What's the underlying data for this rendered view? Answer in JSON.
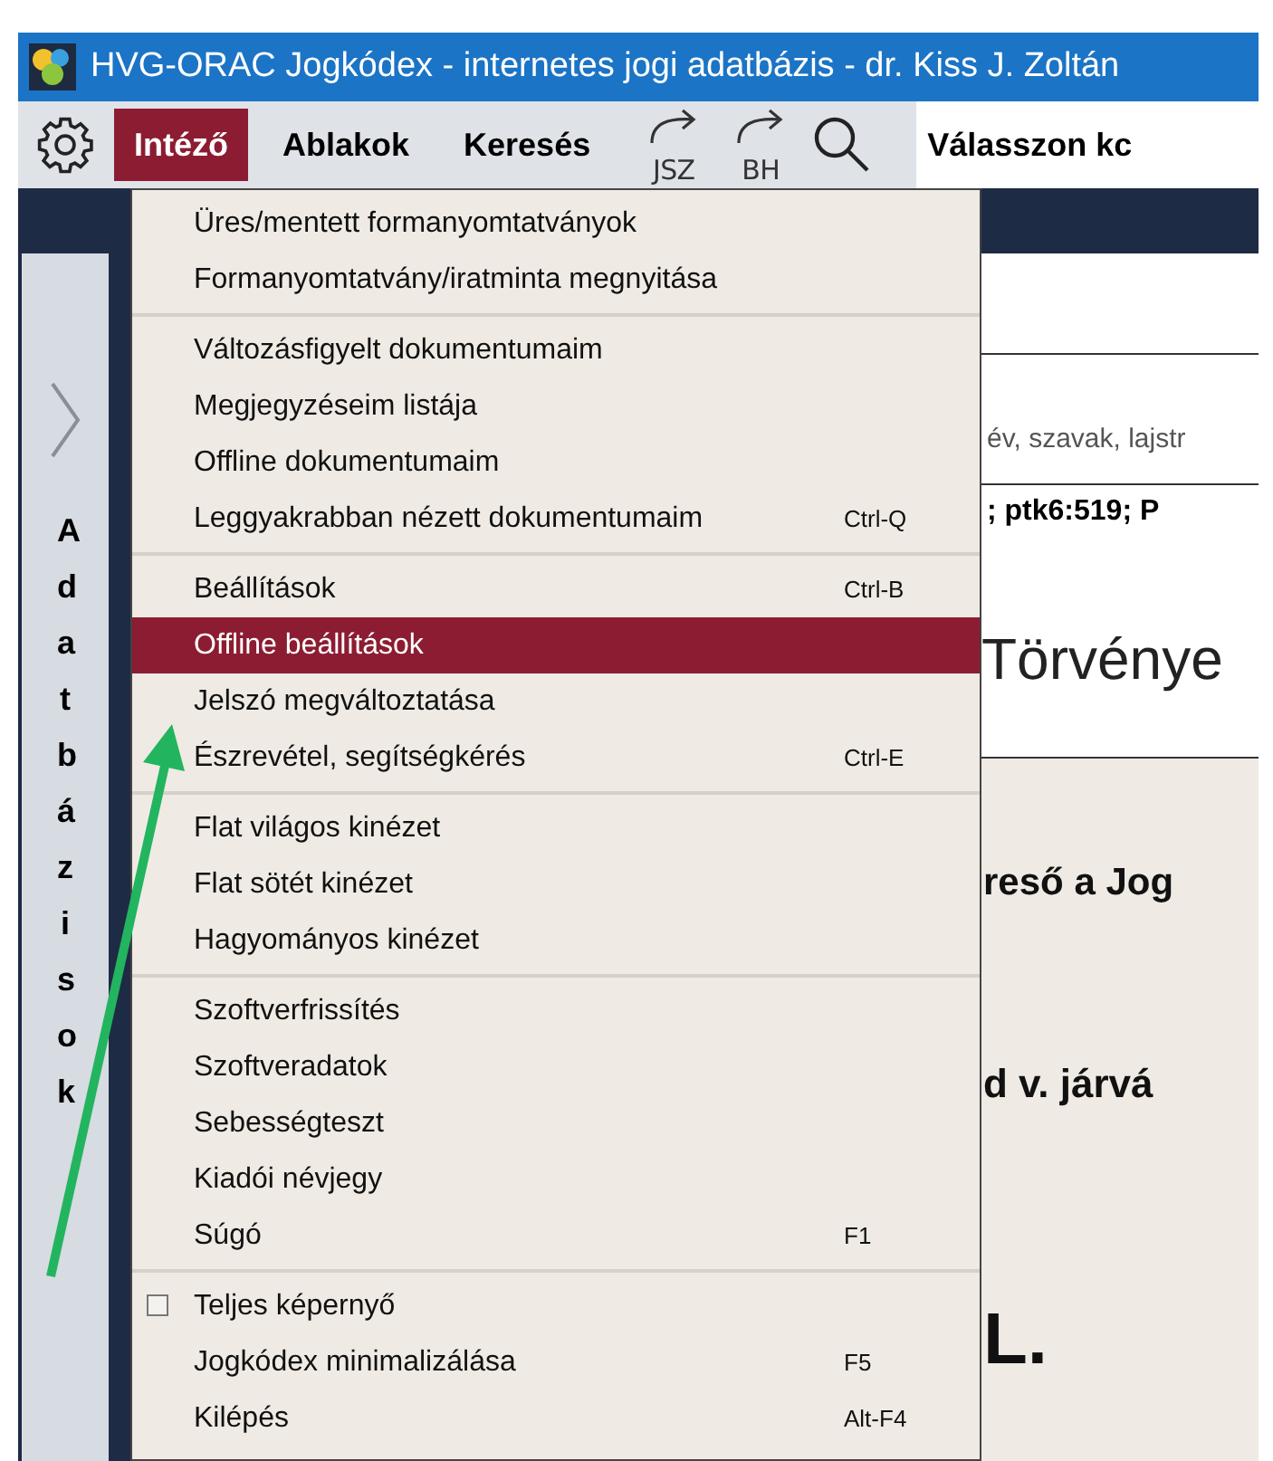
{
  "window": {
    "title": "HVG-ORAC Jogkódex - internetes jogi adatbázis - dr. Kiss J. Zoltán"
  },
  "menu_bar": {
    "items": [
      {
        "label": "Intéző",
        "selected": true
      },
      {
        "label": "Ablakok",
        "selected": false
      },
      {
        "label": "Keresés",
        "selected": false
      }
    ],
    "tools": [
      {
        "label": "JSZ"
      },
      {
        "label": "BH"
      }
    ],
    "category_dropdown": {
      "value": "Válasszon kc"
    }
  },
  "sidebar": {
    "label": "Adatbázisok"
  },
  "content": {
    "hint": "év, szavak, lajstr",
    "query": "; ptk6:519; P",
    "heading": "Törvénye",
    "lines": [
      "reső a Jog",
      "d v. járvá",
      "L."
    ]
  },
  "dropdown_menu": {
    "groups": [
      {
        "items": [
          {
            "kind": "command",
            "label": "Üres/mentett formanyomtatványok",
            "selected": false
          },
          {
            "kind": "command",
            "label": "Formanyomtatvány/iratminta megnyitása",
            "selected": false
          }
        ]
      },
      {
        "items": [
          {
            "kind": "command",
            "label": "Változásfigyelt dokumentumaim",
            "selected": false
          },
          {
            "kind": "command",
            "label": "Megjegyzéseim listája",
            "selected": false
          },
          {
            "kind": "command",
            "label": "Offline dokumentumaim",
            "selected": false
          },
          {
            "kind": "command",
            "label": "Leggyakrabban nézett dokumentumaim",
            "shortcut": "Ctrl-Q",
            "selected": false
          }
        ]
      },
      {
        "items": [
          {
            "kind": "command",
            "label": "Beállítások",
            "shortcut": "Ctrl-B",
            "selected": false
          },
          {
            "kind": "command",
            "label": "Offline beállítások",
            "selected": true
          },
          {
            "kind": "command",
            "label": "Jelszó megváltoztatása",
            "selected": false
          },
          {
            "kind": "command",
            "label": "Észrevétel, segítségkérés",
            "shortcut": "Ctrl-E",
            "selected": false
          }
        ]
      },
      {
        "items": [
          {
            "kind": "command",
            "label": "Flat világos kinézet",
            "selected": false
          },
          {
            "kind": "command",
            "label": "Flat sötét kinézet",
            "selected": false
          },
          {
            "kind": "command",
            "label": "Hagyományos kinézet",
            "selected": false
          }
        ]
      },
      {
        "items": [
          {
            "kind": "command",
            "label": "Szoftverfrissítés",
            "selected": false
          },
          {
            "kind": "command",
            "label": "Szoftveradatok",
            "selected": false
          },
          {
            "kind": "command",
            "label": "Sebességteszt",
            "selected": false
          },
          {
            "kind": "command",
            "label": "Kiadói névjegy",
            "selected": false
          },
          {
            "kind": "command",
            "label": "Súgó",
            "shortcut": "F1",
            "selected": false
          }
        ]
      },
      {
        "items": [
          {
            "kind": "checkbox",
            "label": "Teljes képernyő",
            "checked": false,
            "selected": false
          },
          {
            "kind": "command",
            "label": "Jogkódex minimalizálása",
            "shortcut": "F5",
            "selected": false
          },
          {
            "kind": "command",
            "label": "Kilépés",
            "shortcut": "Alt-F4",
            "selected": false
          }
        ]
      }
    ]
  }
}
